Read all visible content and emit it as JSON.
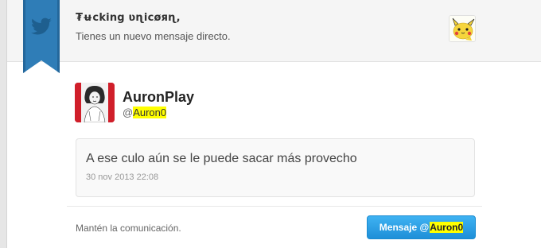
{
  "notification": {
    "sender_name": "₮ʉcking ʋɳicøяɳ,",
    "text": "Tienes un nuevo mensaje directo."
  },
  "profile": {
    "name": "AuronPlay",
    "handle_prefix": "@",
    "handle": "Auron0"
  },
  "message": {
    "text": "A ese culo aún se le puede sacar más provecho",
    "timestamp": "30 nov 2013 22:08"
  },
  "footer": {
    "text": "Mantén la comunicación.",
    "button_prefix": "Mensaje @",
    "button_handle": "Auron0"
  },
  "colors": {
    "ribbon": "#2f7db7",
    "button": "#2a9ee6",
    "highlight": "#ffff00"
  },
  "icons": {
    "ribbon": "twitter-bird-icon",
    "header_avatar": "pikachu-avatar",
    "profile_avatar": "sketch-portrait-avatar"
  }
}
